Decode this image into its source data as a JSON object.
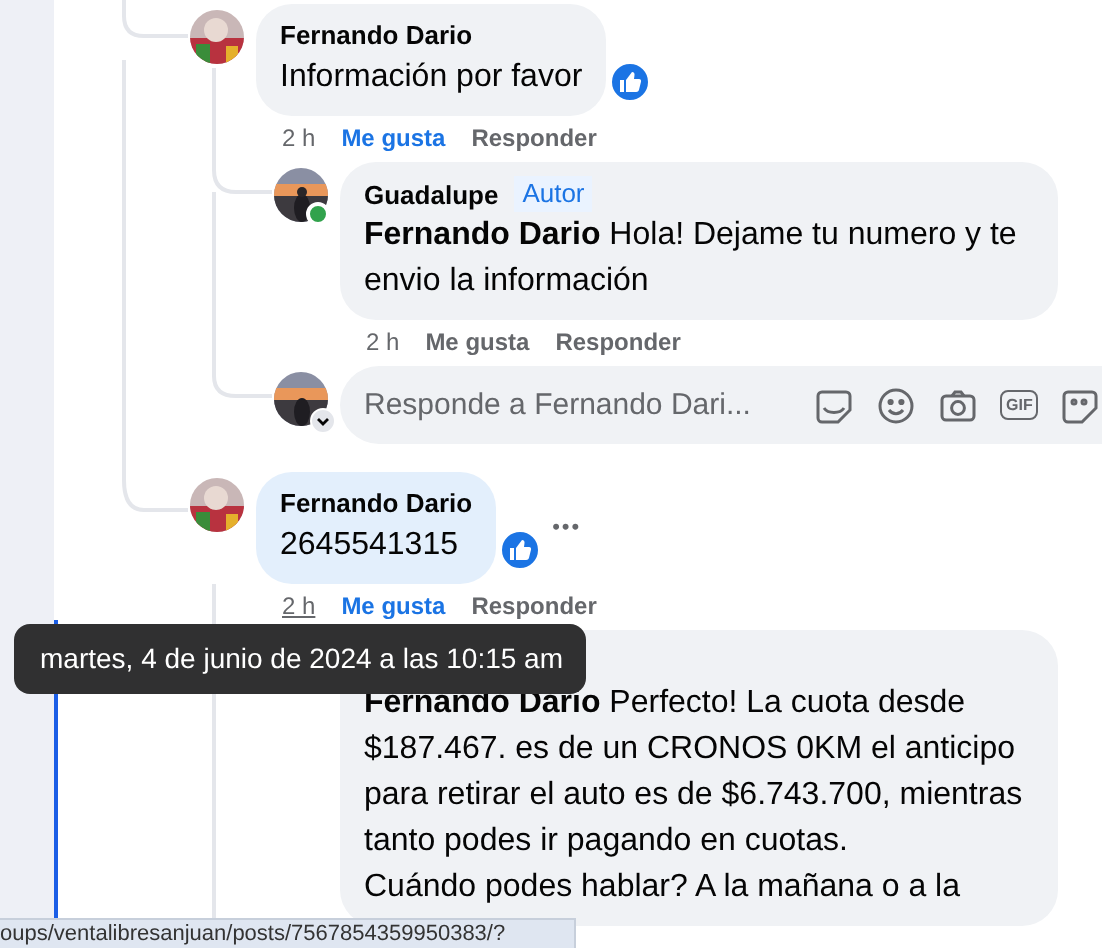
{
  "thread": [
    {
      "author": "Fernando Dario",
      "text": "Información por favor",
      "highlighted": false,
      "reacted": true,
      "actions": {
        "time": "2 h",
        "time_underlined": false,
        "like": "Me gusta",
        "liked": true,
        "reply": "Responder"
      },
      "replies": [
        {
          "author": "Guadalupe",
          "badge": "Autor",
          "online": true,
          "text": "**Fernando Dario** Hola! Dejame tu numero y te envio la información",
          "actions": {
            "time": "2 h",
            "time_underlined": false,
            "like": "Me gusta",
            "liked": false,
            "reply": "Responder"
          }
        }
      ],
      "composer": {
        "placeholder": "Responde a Fernando Dari...",
        "gif": "GIF"
      }
    },
    {
      "author": "Fernando Dario",
      "text": "2645541315",
      "highlighted": true,
      "reacted": true,
      "more": "•••",
      "actions": {
        "time": "2 h",
        "time_underlined": true,
        "like": "Me gusta",
        "liked": true,
        "reply": "Responder"
      },
      "replies": [
        {
          "text": "**Fernando Dario** Perfecto! La cuota desde $187.467. es de un CRONOS 0KM el anticipo para retirar el auto es de $6.743.700, mientras tanto podes ir pagando en cuotas.\nCuándo podes hablar? A la mañana o a la"
        }
      ]
    }
  ],
  "tooltip": {
    "text": "martes, 4 de junio de 2024 a las 10:15 am"
  },
  "status_bar": {
    "url": "oups/ventalibresanjuan/posts/7567854359950383/?"
  }
}
